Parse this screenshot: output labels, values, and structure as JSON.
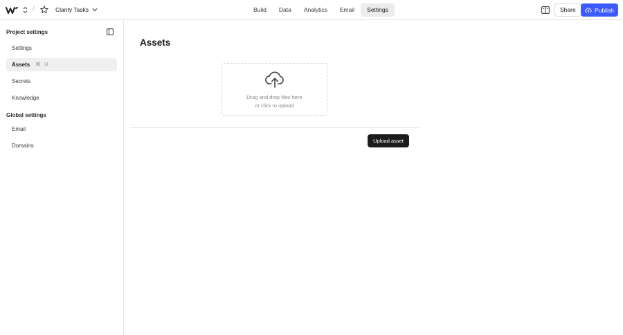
{
  "header": {
    "project_name": "Clarity Tasks",
    "nav": [
      {
        "label": "Build"
      },
      {
        "label": "Data"
      },
      {
        "label": "Analytics"
      },
      {
        "label": "Email"
      },
      {
        "label": "Settings",
        "active": true
      }
    ],
    "share_label": "Share",
    "publish_label": "Publish",
    "accent_color": "#3b5bfd"
  },
  "sidebar": {
    "project_heading": "Project settings",
    "project_items": [
      {
        "label": "Settings"
      },
      {
        "label": "Assets",
        "active": true,
        "shortcut": "⌘ U"
      },
      {
        "label": "Secrets"
      },
      {
        "label": "Knowledge"
      }
    ],
    "global_heading": "Global settings",
    "global_items": [
      {
        "label": "Email"
      },
      {
        "label": "Domains"
      }
    ]
  },
  "main": {
    "title": "Assets",
    "dropzone": {
      "line1": "Drag and drop files here",
      "line2": "or click to upload"
    },
    "upload_button": "Upload asset"
  }
}
